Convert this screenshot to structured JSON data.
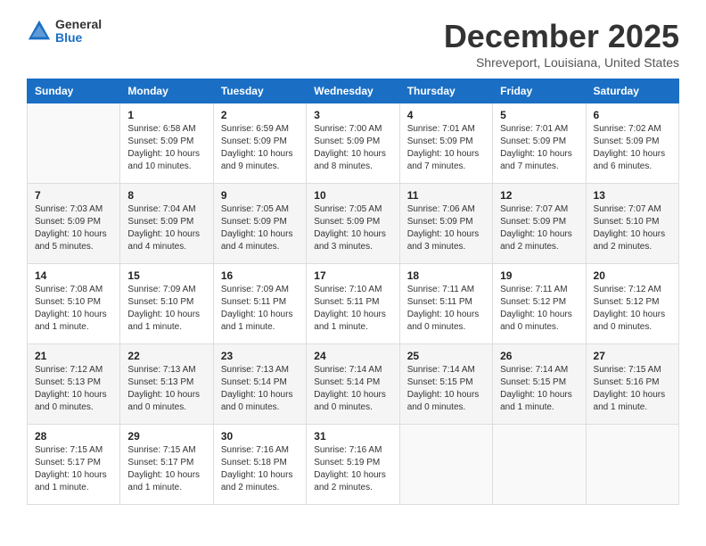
{
  "logo": {
    "general": "General",
    "blue": "Blue"
  },
  "title": "December 2025",
  "location": "Shreveport, Louisiana, United States",
  "weekdays": [
    "Sunday",
    "Monday",
    "Tuesday",
    "Wednesday",
    "Thursday",
    "Friday",
    "Saturday"
  ],
  "weeks": [
    [
      {
        "day": "",
        "info": ""
      },
      {
        "day": "1",
        "info": "Sunrise: 6:58 AM\nSunset: 5:09 PM\nDaylight: 10 hours\nand 10 minutes."
      },
      {
        "day": "2",
        "info": "Sunrise: 6:59 AM\nSunset: 5:09 PM\nDaylight: 10 hours\nand 9 minutes."
      },
      {
        "day": "3",
        "info": "Sunrise: 7:00 AM\nSunset: 5:09 PM\nDaylight: 10 hours\nand 8 minutes."
      },
      {
        "day": "4",
        "info": "Sunrise: 7:01 AM\nSunset: 5:09 PM\nDaylight: 10 hours\nand 7 minutes."
      },
      {
        "day": "5",
        "info": "Sunrise: 7:01 AM\nSunset: 5:09 PM\nDaylight: 10 hours\nand 7 minutes."
      },
      {
        "day": "6",
        "info": "Sunrise: 7:02 AM\nSunset: 5:09 PM\nDaylight: 10 hours\nand 6 minutes."
      }
    ],
    [
      {
        "day": "7",
        "info": "Sunrise: 7:03 AM\nSunset: 5:09 PM\nDaylight: 10 hours\nand 5 minutes."
      },
      {
        "day": "8",
        "info": "Sunrise: 7:04 AM\nSunset: 5:09 PM\nDaylight: 10 hours\nand 4 minutes."
      },
      {
        "day": "9",
        "info": "Sunrise: 7:05 AM\nSunset: 5:09 PM\nDaylight: 10 hours\nand 4 minutes."
      },
      {
        "day": "10",
        "info": "Sunrise: 7:05 AM\nSunset: 5:09 PM\nDaylight: 10 hours\nand 3 minutes."
      },
      {
        "day": "11",
        "info": "Sunrise: 7:06 AM\nSunset: 5:09 PM\nDaylight: 10 hours\nand 3 minutes."
      },
      {
        "day": "12",
        "info": "Sunrise: 7:07 AM\nSunset: 5:09 PM\nDaylight: 10 hours\nand 2 minutes."
      },
      {
        "day": "13",
        "info": "Sunrise: 7:07 AM\nSunset: 5:10 PM\nDaylight: 10 hours\nand 2 minutes."
      }
    ],
    [
      {
        "day": "14",
        "info": "Sunrise: 7:08 AM\nSunset: 5:10 PM\nDaylight: 10 hours\nand 1 minute."
      },
      {
        "day": "15",
        "info": "Sunrise: 7:09 AM\nSunset: 5:10 PM\nDaylight: 10 hours\nand 1 minute."
      },
      {
        "day": "16",
        "info": "Sunrise: 7:09 AM\nSunset: 5:11 PM\nDaylight: 10 hours\nand 1 minute."
      },
      {
        "day": "17",
        "info": "Sunrise: 7:10 AM\nSunset: 5:11 PM\nDaylight: 10 hours\nand 1 minute."
      },
      {
        "day": "18",
        "info": "Sunrise: 7:11 AM\nSunset: 5:11 PM\nDaylight: 10 hours\nand 0 minutes."
      },
      {
        "day": "19",
        "info": "Sunrise: 7:11 AM\nSunset: 5:12 PM\nDaylight: 10 hours\nand 0 minutes."
      },
      {
        "day": "20",
        "info": "Sunrise: 7:12 AM\nSunset: 5:12 PM\nDaylight: 10 hours\nand 0 minutes."
      }
    ],
    [
      {
        "day": "21",
        "info": "Sunrise: 7:12 AM\nSunset: 5:13 PM\nDaylight: 10 hours\nand 0 minutes."
      },
      {
        "day": "22",
        "info": "Sunrise: 7:13 AM\nSunset: 5:13 PM\nDaylight: 10 hours\nand 0 minutes."
      },
      {
        "day": "23",
        "info": "Sunrise: 7:13 AM\nSunset: 5:14 PM\nDaylight: 10 hours\nand 0 minutes."
      },
      {
        "day": "24",
        "info": "Sunrise: 7:14 AM\nSunset: 5:14 PM\nDaylight: 10 hours\nand 0 minutes."
      },
      {
        "day": "25",
        "info": "Sunrise: 7:14 AM\nSunset: 5:15 PM\nDaylight: 10 hours\nand 0 minutes."
      },
      {
        "day": "26",
        "info": "Sunrise: 7:14 AM\nSunset: 5:15 PM\nDaylight: 10 hours\nand 1 minute."
      },
      {
        "day": "27",
        "info": "Sunrise: 7:15 AM\nSunset: 5:16 PM\nDaylight: 10 hours\nand 1 minute."
      }
    ],
    [
      {
        "day": "28",
        "info": "Sunrise: 7:15 AM\nSunset: 5:17 PM\nDaylight: 10 hours\nand 1 minute."
      },
      {
        "day": "29",
        "info": "Sunrise: 7:15 AM\nSunset: 5:17 PM\nDaylight: 10 hours\nand 1 minute."
      },
      {
        "day": "30",
        "info": "Sunrise: 7:16 AM\nSunset: 5:18 PM\nDaylight: 10 hours\nand 2 minutes."
      },
      {
        "day": "31",
        "info": "Sunrise: 7:16 AM\nSunset: 5:19 PM\nDaylight: 10 hours\nand 2 minutes."
      },
      {
        "day": "",
        "info": ""
      },
      {
        "day": "",
        "info": ""
      },
      {
        "day": "",
        "info": ""
      }
    ]
  ]
}
